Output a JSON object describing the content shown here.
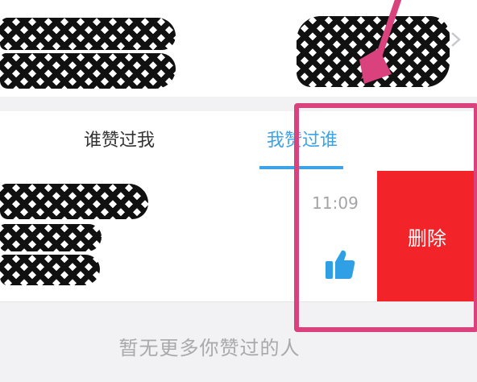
{
  "tabs": [
    {
      "label": "谁赞过我"
    },
    {
      "label": "我赞过谁"
    }
  ],
  "list_item": {
    "time": "11:09",
    "delete_label": "删除",
    "thumb_icon": "thumbs-up-icon"
  },
  "empty_message": "暂无更多你赞过的人",
  "colors": {
    "accent": "#3ba3e6",
    "delete": "#f2242a",
    "highlight": "#d9427d"
  }
}
